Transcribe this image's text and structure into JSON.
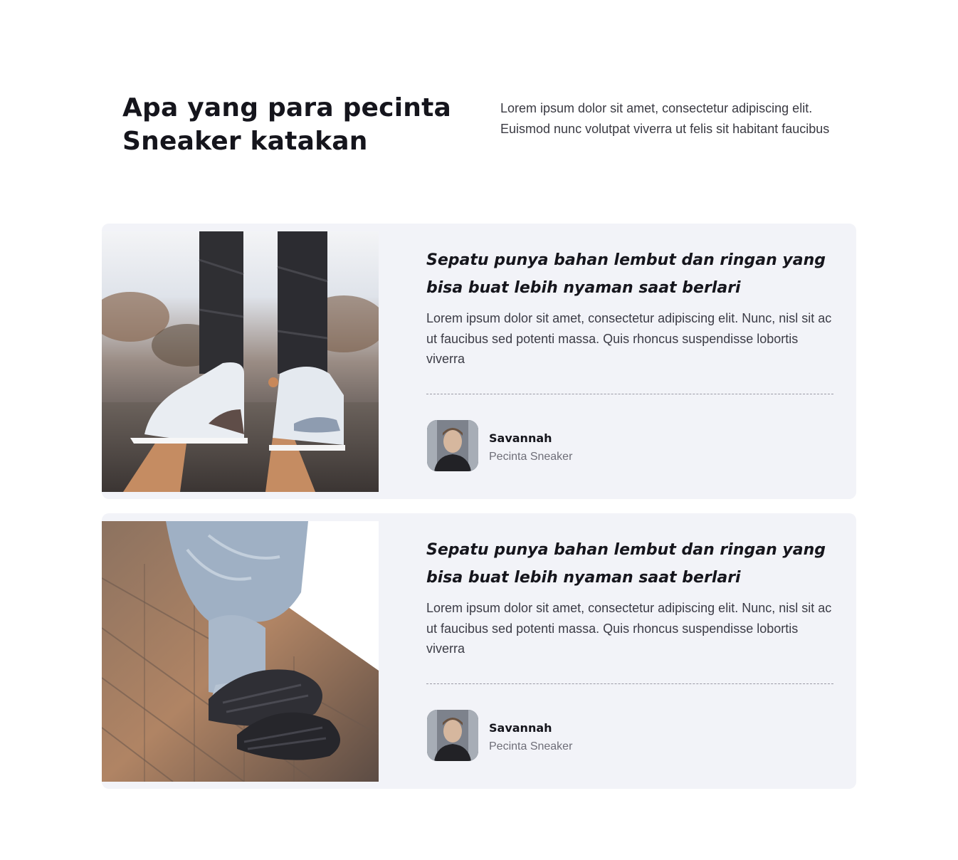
{
  "header": {
    "title": "Apa yang para pecinta Sneaker katakan",
    "description": "Lorem ipsum dolor sit amet, consectetur adipiscing elit. Euismod nunc volutpat viverra ut felis sit habitant faucibus"
  },
  "testimonials": [
    {
      "title": "Sepatu punya bahan lembut dan ringan yang bisa buat lebih nyaman saat berlari",
      "body": "Lorem ipsum dolor sit amet, consectetur adipiscing elit. Nunc, nisl sit ac ut faucibus sed potenti massa. Quis rhoncus suspendisse lobortis viverra",
      "author": "Savannah",
      "role": "Pecinta Sneaker"
    },
    {
      "title": "Sepatu punya bahan lembut dan ringan yang bisa buat lebih nyaman saat berlari",
      "body": "Lorem ipsum dolor sit amet, consectetur adipiscing elit. Nunc, nisl sit ac ut faucibus sed potenti massa. Quis rhoncus suspendisse lobortis viverra",
      "author": "Savannah",
      "role": "Pecinta Sneaker"
    }
  ],
  "colors": {
    "card_background": "#f2f3f8",
    "heading": "#15151c",
    "body_text": "#3b3b45",
    "accent_orange": "#c8885a"
  }
}
